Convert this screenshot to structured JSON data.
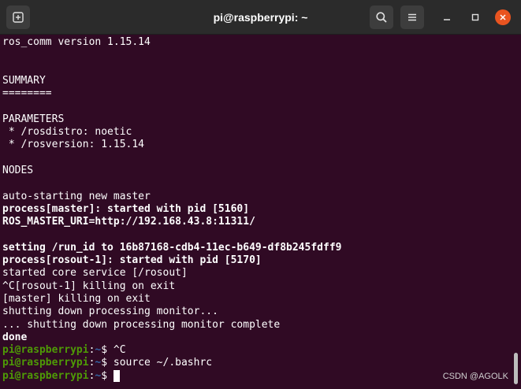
{
  "window": {
    "title": "pi@raspberrypi: ~"
  },
  "icons": {
    "new_tab": "new-tab-icon",
    "search": "search-icon",
    "menu": "hamburger-menu-icon",
    "minimize": "minimize-icon",
    "maximize": "maximize-icon",
    "close": "close-icon"
  },
  "colors": {
    "terminal_bg": "#300a24",
    "titlebar_bg": "#2b2b2b",
    "prompt_user": "#4e9a06",
    "prompt_path": "#3465a4",
    "close_button": "#e95420"
  },
  "terminal": {
    "lines": [
      {
        "text": "ros_comm version 1.15.14",
        "bold": false
      },
      {
        "text": "",
        "bold": false
      },
      {
        "text": "",
        "bold": false
      },
      {
        "text": "SUMMARY",
        "bold": false
      },
      {
        "text": "========",
        "bold": false
      },
      {
        "text": "",
        "bold": false
      },
      {
        "text": "PARAMETERS",
        "bold": false
      },
      {
        "text": " * /rosdistro: noetic",
        "bold": false
      },
      {
        "text": " * /rosversion: 1.15.14",
        "bold": false
      },
      {
        "text": "",
        "bold": false
      },
      {
        "text": "NODES",
        "bold": false
      },
      {
        "text": "",
        "bold": false
      },
      {
        "text": "auto-starting new master",
        "bold": false
      },
      {
        "text": "process[master]: started with pid [5160]",
        "bold": true
      },
      {
        "text": "ROS_MASTER_URI=http://192.168.43.8:11311/",
        "bold": true
      },
      {
        "text": "",
        "bold": false
      },
      {
        "text": "setting /run_id to 16b87168-cdb4-11ec-b649-df8b245fdff9",
        "bold": true
      },
      {
        "text": "process[rosout-1]: started with pid [5170]",
        "bold": true
      },
      {
        "text": "started core service [/rosout]",
        "bold": false
      },
      {
        "text": "^C[rosout-1] killing on exit",
        "bold": false
      },
      {
        "text": "[master] killing on exit",
        "bold": false
      },
      {
        "text": "shutting down processing monitor...",
        "bold": false
      },
      {
        "text": "... shutting down processing monitor complete",
        "bold": false
      },
      {
        "text": "done",
        "bold": true
      }
    ],
    "prompts": [
      {
        "user": "pi@raspberrypi",
        "sep": ":",
        "path": "~",
        "symbol": "$ ",
        "command": "^C"
      },
      {
        "user": "pi@raspberrypi",
        "sep": ":",
        "path": "~",
        "symbol": "$ ",
        "command": "source ~/.bashrc"
      },
      {
        "user": "pi@raspberrypi",
        "sep": ":",
        "path": "~",
        "symbol": "$ ",
        "command": ""
      }
    ]
  },
  "watermark": "CSDN @AGOLK"
}
